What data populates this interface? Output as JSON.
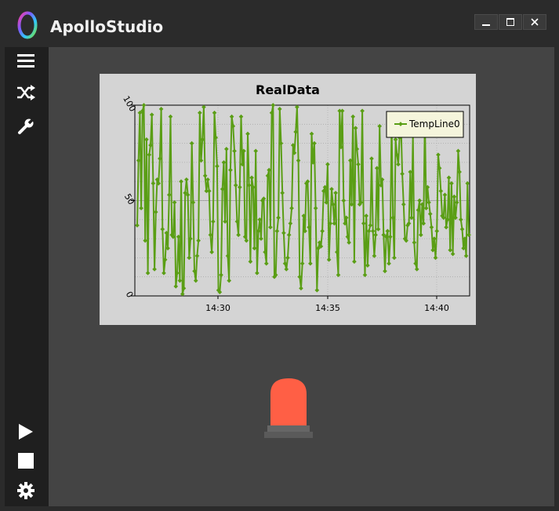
{
  "app": {
    "title": "ApolloStudio",
    "window_controls": [
      "minimize-icon",
      "maximize-icon",
      "close-icon"
    ]
  },
  "sidebar": {
    "top_items": [
      {
        "icon": "menu-icon"
      },
      {
        "icon": "shuffle-icon"
      },
      {
        "icon": "wrench-icon"
      }
    ],
    "bottom_items": [
      {
        "icon": "play-icon"
      },
      {
        "icon": "stop-icon"
      },
      {
        "icon": "settings-icon"
      }
    ]
  },
  "colors": {
    "series": "#5a9e15",
    "beacon": "#ff5f45",
    "beacon_base": "#666666"
  },
  "chart_data": {
    "type": "line",
    "title": "RealData",
    "xlabel": "",
    "ylabel": "",
    "ylim": [
      0,
      100
    ],
    "y_ticks": [
      "0",
      "50",
      "100"
    ],
    "x_ticks": [
      "14:30",
      "14:35",
      "14:40"
    ],
    "grid": true,
    "legend": "top-right",
    "series": [
      {
        "name": "TempLine0",
        "values": [
          37,
          71,
          96,
          46,
          97,
          100,
          29,
          82,
          12,
          74,
          79,
          95,
          59,
          14,
          44,
          61,
          59,
          72,
          98,
          35,
          12,
          19,
          33,
          25,
          53,
          94,
          32,
          31,
          49,
          5,
          12,
          31,
          8,
          60,
          1,
          4,
          54,
          61,
          53,
          20,
          30,
          80,
          49,
          13,
          8,
          21,
          29,
          96,
          71,
          82,
          99,
          63,
          55,
          61,
          55,
          32,
          23,
          39,
          96,
          83,
          68,
          3,
          2,
          11,
          56,
          70,
          39,
          77,
          21,
          8,
          66,
          94,
          89,
          76,
          58,
          39,
          32,
          57,
          94,
          69,
          76,
          31,
          29,
          85,
          58,
          18,
          62,
          57,
          25,
          76,
          12,
          34,
          40,
          30,
          50,
          51,
          23,
          17,
          63,
          66,
          36,
          96,
          100,
          10,
          11,
          34,
          41,
          98,
          80,
          54,
          33,
          17,
          14,
          20,
          32,
          38,
          46,
          79,
          75,
          86,
          99,
          71,
          10,
          4,
          17,
          42,
          34,
          59,
          60,
          36,
          17,
          85,
          70,
          80,
          46,
          3,
          25,
          28,
          26,
          34,
          55,
          57,
          49,
          69,
          19,
          38,
          56,
          48,
          38,
          54,
          23,
          11,
          97,
          78,
          97,
          50,
          38,
          41,
          31,
          28,
          71,
          48,
          94,
          18,
          88,
          77,
          69,
          48,
          49,
          97,
          38,
          11,
          42,
          16,
          34,
          37,
          72,
          34,
          21,
          32,
          67,
          35,
          89,
          58,
          61,
          32,
          13,
          31,
          34,
          17,
          31,
          91,
          41,
          20,
          82,
          74,
          69,
          83,
          91,
          64,
          48,
          30,
          29,
          37,
          38,
          65,
          41,
          85,
          28,
          17,
          14,
          45,
          50,
          32,
          48,
          38,
          94,
          46,
          57,
          49,
          43,
          36,
          24,
          30,
          20,
          34,
          74,
          67,
          55,
          42,
          41,
          53,
          36,
          40,
          62,
          24,
          59,
          22,
          52,
          41,
          49,
          76,
          65,
          40,
          35,
          25,
          30,
          21,
          59,
          32
        ]
      }
    ]
  }
}
